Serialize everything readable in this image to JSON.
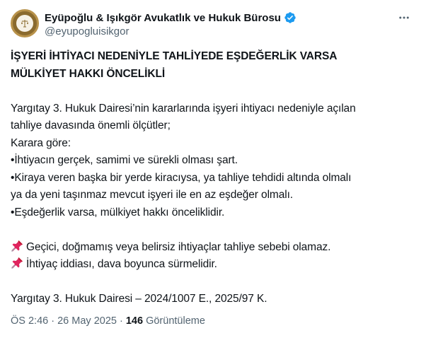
{
  "author": {
    "display_name": "Eyüpoğlu & Işıkgör Avukatlık ve Hukuk Bürosu",
    "handle": "@eyupogluisikgor",
    "verified": true,
    "verified_color": "#1d9bf0"
  },
  "post": {
    "title_line_1": "İŞYERİ İHTİYACI NEDENİYLE TAHLİYEDE EŞDEĞERLİK VARSA",
    "title_line_2": "MÜLKİYET HAKKI ÖNCELİKLİ",
    "intro_line_1": "Yargıtay 3. Hukuk Dairesi’nin kararlarında işyeri ihtiyacı nedeniyle açılan",
    "intro_line_2": "tahliye davasında önemli ölçütler;",
    "karar_label": "Karara göre:",
    "bullet_1": "•İhtiyacın gerçek, samimi ve sürekli olması şart.",
    "bullet_2_line_1": "•Kiraya veren başka bir yerde kiracıysa, ya tahliye tehdidi altında olmalı",
    "bullet_2_line_2": "ya da yeni taşınmaz mevcut işyeri ile en az eşdeğer olmalı.",
    "bullet_3": "•Eşdeğerlik varsa, mülkiyet hakkı önceliklidir.",
    "pin_1": "Geçici, doğmamış veya belirsiz ihtiyaçlar tahliye sebebi olamaz.",
    "pin_2": "İhtiyaç iddiası, dava boyunca sürmelidir.",
    "reference": "Yargıtay 3. Hukuk Dairesi – 2024/1007 E., 2025/97 K."
  },
  "meta": {
    "time": "ÖS 2:46",
    "separator": "·",
    "date": "26 May 2025",
    "views_count": "146",
    "views_label": "Görüntüleme"
  },
  "colors": {
    "text": "#0f1419",
    "secondary": "#536471",
    "pin": "#e0245e"
  },
  "icons": {
    "verified": "verified-badge-icon",
    "more": "more-options-icon",
    "pin": "pushpin-icon"
  }
}
